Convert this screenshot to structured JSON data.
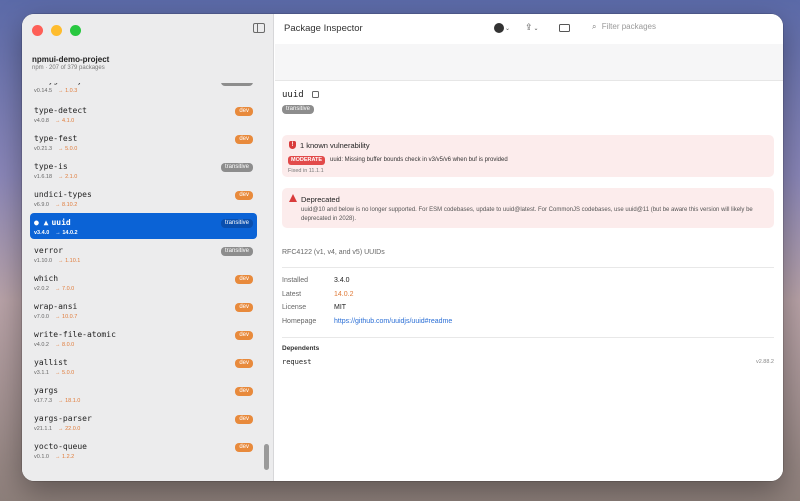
{
  "project": {
    "name": "npmui-demo-project",
    "subtitle": "npm · 207 of 379 packages"
  },
  "window": {
    "title": "Package Inspector"
  },
  "search": {
    "placeholder": "Filter packages"
  },
  "packages": [
    {
      "name": "tinyglobby",
      "version": "v0.14.5",
      "latest": "→ 1.0.3",
      "badge": "transitive",
      "badge_type": "transitive",
      "clipped": true
    },
    {
      "name": "type-detect",
      "version": "v4.0.8",
      "latest": "→ 4.1.0",
      "badge": "dev",
      "badge_type": "dev"
    },
    {
      "name": "type-fest",
      "version": "v0.21.3",
      "latest": "→ 5.0.0",
      "badge": "dev",
      "badge_type": "dev"
    },
    {
      "name": "type-is",
      "version": "v1.6.18",
      "latest": "→ 2.1.0",
      "badge": "transitive",
      "badge_type": "transitive"
    },
    {
      "name": "undici-types",
      "version": "v6.9.0",
      "latest": "→ 8.10.2",
      "badge": "dev",
      "badge_type": "dev"
    },
    {
      "name": "uuid",
      "version": "v3.4.0",
      "latest": "→ 14.0.2",
      "badge": "transitive",
      "badge_type": "transitive",
      "selected": true
    },
    {
      "name": "verror",
      "version": "v1.10.0",
      "latest": "→ 1.10.1",
      "badge": "transitive",
      "badge_type": "transitive"
    },
    {
      "name": "which",
      "version": "v2.0.2",
      "latest": "→ 7.0.0",
      "badge": "dev",
      "badge_type": "dev"
    },
    {
      "name": "wrap-ansi",
      "version": "v7.0.0",
      "latest": "→ 10.0.7",
      "badge": "dev",
      "badge_type": "dev"
    },
    {
      "name": "write-file-atomic",
      "version": "v4.0.2",
      "latest": "→ 8.0.0",
      "badge": "dev",
      "badge_type": "dev"
    },
    {
      "name": "yallist",
      "version": "v3.1.1",
      "latest": "→ 5.0.0",
      "badge": "dev",
      "badge_type": "dev"
    },
    {
      "name": "yargs",
      "version": "v17.7.3",
      "latest": "→ 18.1.0",
      "badge": "dev",
      "badge_type": "dev"
    },
    {
      "name": "yargs-parser",
      "version": "v21.1.1",
      "latest": "→ 22.0.0",
      "badge": "dev",
      "badge_type": "dev"
    },
    {
      "name": "yocto-queue",
      "version": "v0.1.0",
      "latest": "→ 1.2.2",
      "badge": "dev",
      "badge_type": "dev"
    }
  ],
  "detail": {
    "name": "uuid",
    "badge": "transitive",
    "vulnerability": {
      "title": "1 known vulnerability",
      "severity": "MODERATE",
      "description": "uuid: Missing buffer bounds check in v3/v5/v6 when buf is provided",
      "fixed": "Fixed in 11.1.1"
    },
    "deprecated": {
      "title": "Deprecated",
      "message": "uuid@10 and below is no longer supported.  For ESM codebases, update to uuid@latest.  For CommonJS codebases, use uuid@11 (but be aware this version will likely be deprecated in 2028)."
    },
    "description": "RFC4122 (v1, v4, and v5) UUIDs",
    "fields": [
      {
        "label": "Installed",
        "value": "3.4.0"
      },
      {
        "label": "Latest",
        "value": "14.0.2"
      },
      {
        "label": "License",
        "value": "MIT"
      },
      {
        "label": "Homepage",
        "value": "https://github.com/uuidjs/uuid#readme"
      }
    ],
    "dependents_label": "Dependents",
    "dependents": [
      {
        "name": "request",
        "version": "v2.88.2"
      }
    ]
  },
  "colors": {
    "accent": "#0b63d6",
    "dev_badge": "#e88a3c",
    "transitive_badge": "#8d8d8d",
    "alert_bg": "#fcecec",
    "danger": "#d93b3b"
  }
}
